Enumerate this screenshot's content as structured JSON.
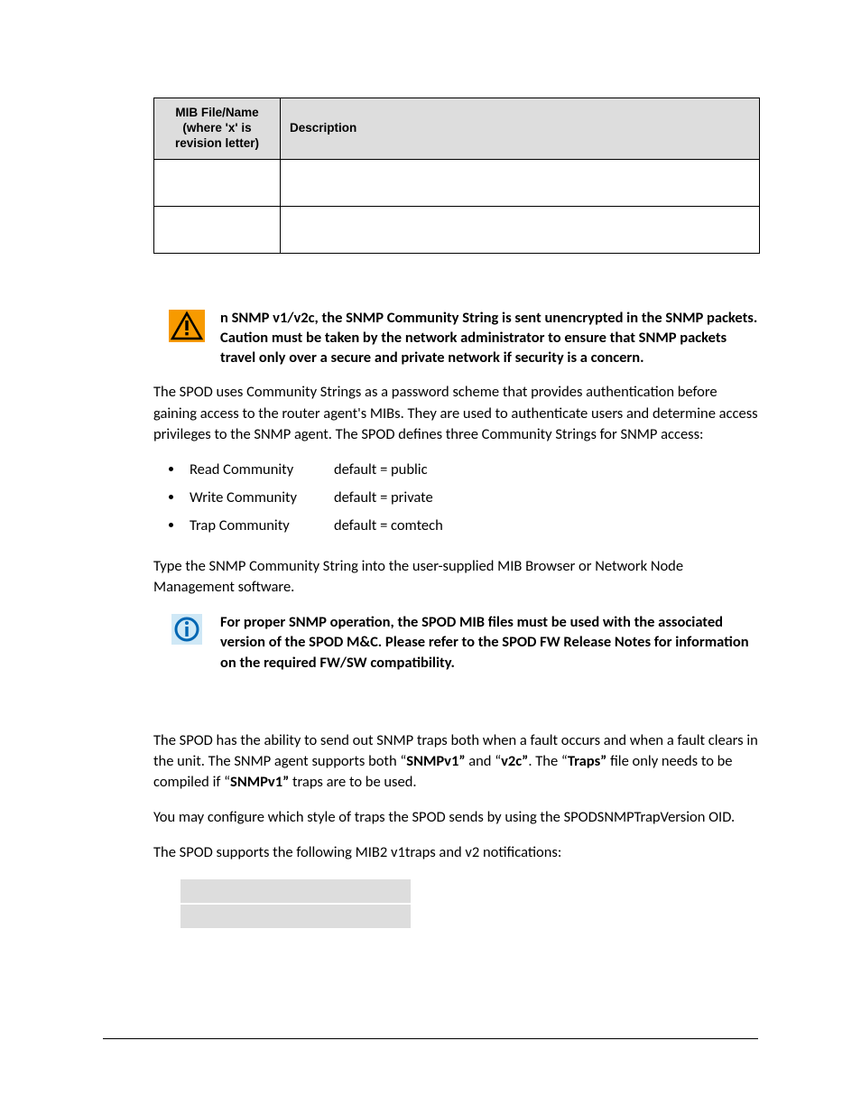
{
  "mib_table": {
    "col1_header": "MIB File/Name (where 'x' is revision letter)",
    "col2_header": "Description"
  },
  "warning": {
    "icon": "warning-icon",
    "text_lead": "n SNMP v1/v2c, the SNMP Community String is sent unencrypted in the SNMP packets. Caution must be taken by the network administrator to ensure that SNMP packets travel only over a secure and private network if security is a concern."
  },
  "community_intro": "The SPOD uses Community Strings as a password scheme that provides authentication before gaining access to the router agent's MIBs. They are used to authenticate users and determine access privileges to the SNMP agent. The SPOD defines three Community Strings for SNMP access:",
  "communities": [
    {
      "label": "Read Community",
      "default": "default = public"
    },
    {
      "label": "Write Community",
      "default": "default = private"
    },
    {
      "label": "Trap Community",
      "default": "default = comtech"
    }
  ],
  "type_instruction": "Type the SNMP Community String into the user-supplied MIB Browser or Network Node Management software.",
  "info": {
    "icon": "info-icon",
    "text": "For proper SNMP operation, the SPOD MIB files must be used with the associated version of the SPOD M&C. Please refer to the SPOD FW Release Notes for information on the required FW/SW compatibility."
  },
  "traps_p1_parts": {
    "a": "The SPOD has the ability to send out SNMP traps both when a fault occurs and when a fault clears in the unit. The SNMP agent supports both “",
    "b": "SNMPv1”",
    "c": " and “",
    "d": "v2c”",
    "e": ". The “",
    "f": "Traps”",
    "g": " file only needs to be compiled if “",
    "h": "SNMPv1”",
    "i": " traps are to be used."
  },
  "traps_p2": "You may configure which style of traps the SPOD sends by using the SPODSNMPTrapVersion OID.",
  "traps_p3": "The SPOD supports the following MIB2 v1traps and v2 notifications:"
}
